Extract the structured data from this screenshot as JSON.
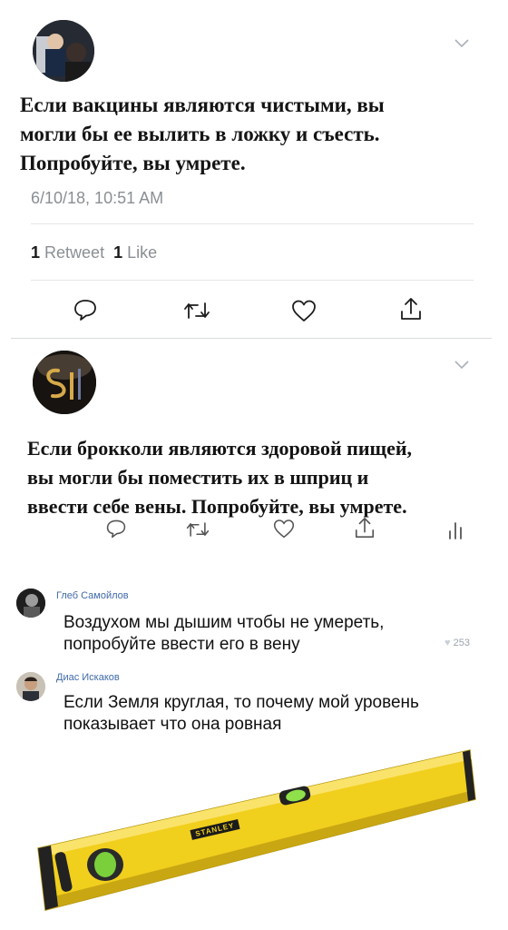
{
  "tweet1": {
    "text_lines": [
      "Если вакцины являются чистыми, вы",
      "могли бы ее вылить в ложку и съесть.",
      "Попробуйте, вы умрете."
    ],
    "timestamp": "6/10/18, 10:51 AM",
    "retweet_count": "1",
    "retweet_label": "Retweet",
    "like_count": "1",
    "like_label": "Like"
  },
  "tweet2": {
    "text_lines": [
      "Если брокколи являются здоровой пищей,",
      "вы могли бы поместить их в шприц и",
      "ввести себе вены. Попробуйте, вы умрете."
    ]
  },
  "comments": [
    {
      "author": "Глеб Самойлов",
      "text_lines": [
        "Воздухом мы дышим чтобы не умереть,",
        "попробуйте ввести его в вену"
      ],
      "likes": "253"
    },
    {
      "author": "Диас Искаков",
      "text_lines": [
        "Если Земля круглая, то почему мой уровень",
        "показывает что она ровная"
      ]
    }
  ],
  "level_brand": "STANLEY",
  "colors": {
    "level_yellow": "#f3d21b",
    "comment_author": "#3f6aa8",
    "like_icon": "#c9cfd6"
  },
  "icons": [
    "chevron-down-icon",
    "reply-icon",
    "retweet-icon",
    "like-icon",
    "share-icon",
    "analytics-icon"
  ]
}
